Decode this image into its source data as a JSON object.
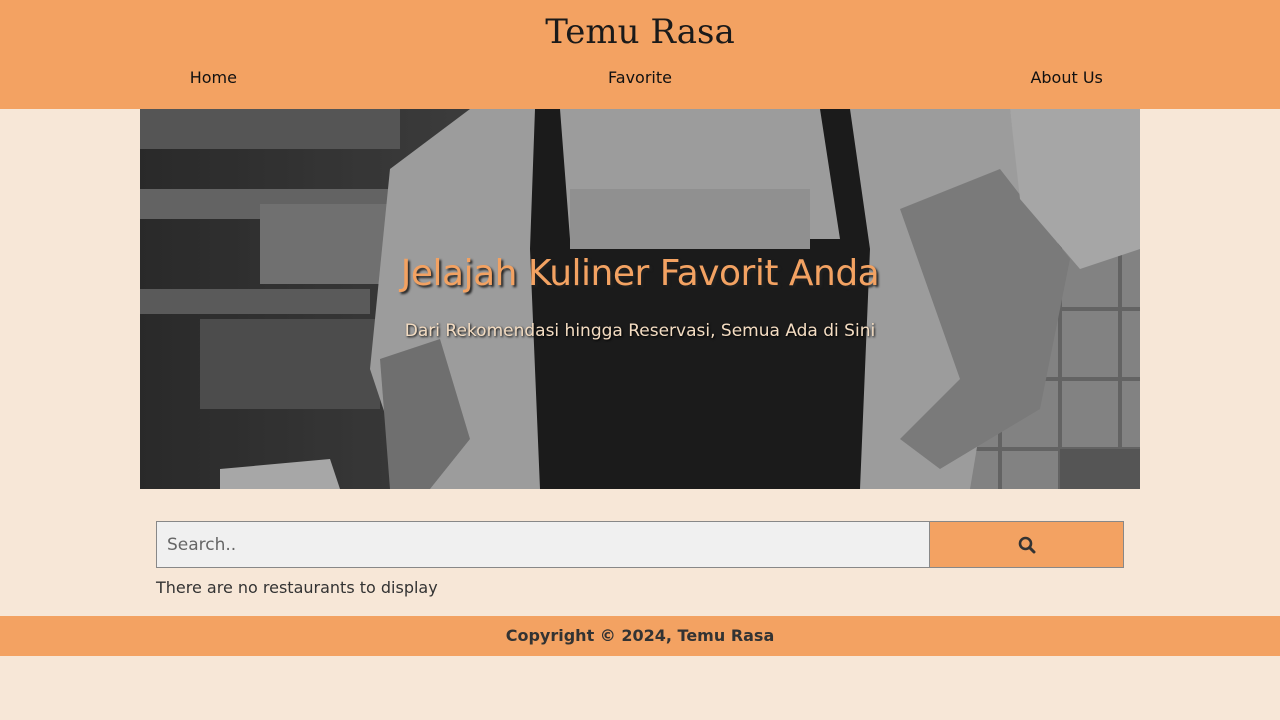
{
  "header": {
    "brand": "Temu Rasa",
    "nav": [
      {
        "label": "Home"
      },
      {
        "label": "Favorite"
      },
      {
        "label": "About Us"
      }
    ]
  },
  "hero": {
    "title": "Jelajah Kuliner Favorit Anda",
    "subtitle": "Dari Rekomendasi hingga Reservasi, Semua Ada di Sini"
  },
  "search": {
    "placeholder": "Search..",
    "button_icon": "search-icon"
  },
  "restaurants": {
    "empty_message": "There are no restaurants to display"
  },
  "footer": {
    "text": "Copyright © 2024, Temu Rasa"
  },
  "colors": {
    "accent": "#f3a262",
    "background": "#f7e7d7"
  }
}
